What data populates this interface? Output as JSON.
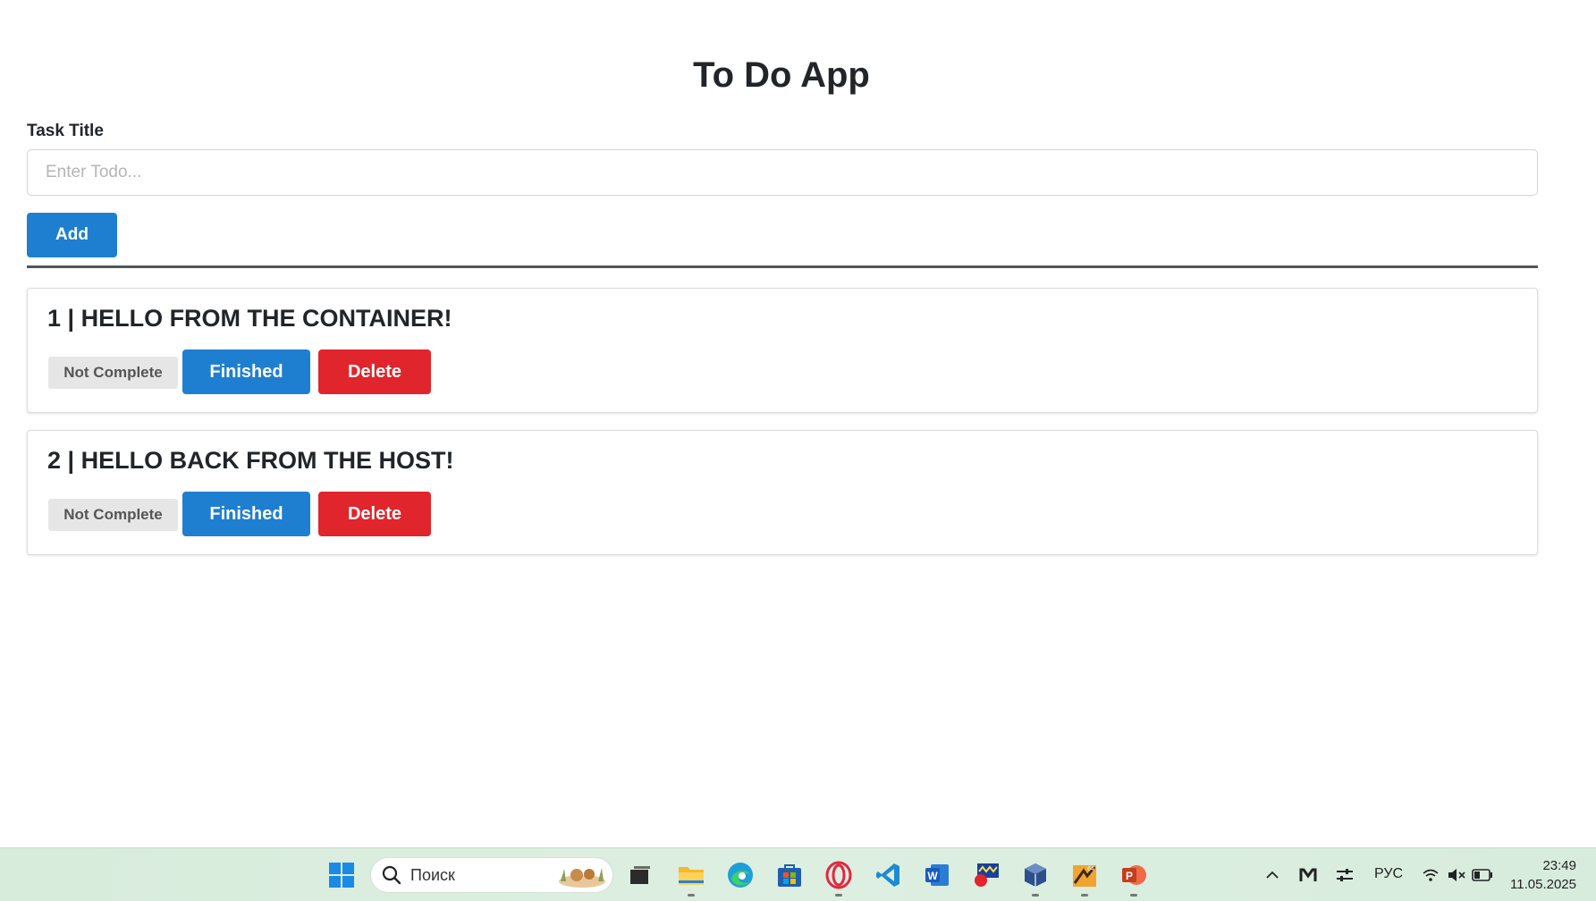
{
  "app": {
    "title": "To Do App",
    "form": {
      "label": "Task Title",
      "input_value": "",
      "input_placeholder": "Enter Todo...",
      "add_label": "Add"
    },
    "todos": [
      {
        "title": "1 | HELLO FROM THE CONTAINER!",
        "status": "Not Complete",
        "finished_label": "Finished",
        "delete_label": "Delete"
      },
      {
        "title": "2 | HELLO BACK FROM THE HOST!",
        "status": "Not Complete",
        "finished_label": "Finished",
        "delete_label": "Delete"
      }
    ]
  },
  "colors": {
    "primary": "#1e7fd0",
    "danger": "#e0252c",
    "badge_bg": "#e6e6e6"
  },
  "taskbar": {
    "search_placeholder": "Поиск",
    "pinned_icons": [
      "windows-start-icon",
      "file-manager-icon",
      "folder-icon",
      "edge-browser-icon",
      "store-icon",
      "opera-browser-icon",
      "vscode-icon",
      "word-icon",
      "app-icon",
      "virtualbox-icon",
      "app-64-icon",
      "powerpoint-icon"
    ],
    "tray": {
      "language": "РУС",
      "time": "23:49",
      "date": "11.05.2025"
    }
  }
}
